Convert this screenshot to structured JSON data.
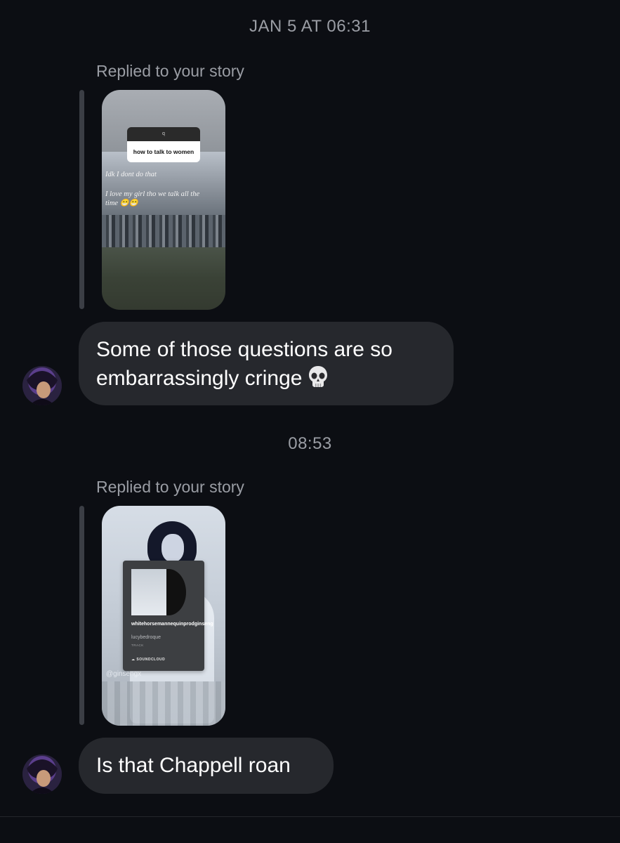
{
  "conversation": {
    "timestamp_1": "JAN 5 AT 06:31",
    "timestamp_2": "08:53",
    "messages": [
      {
        "reply_label": "Replied to your story",
        "story": {
          "question_sticker_top": "q",
          "question_sticker_text": "how to talk to women",
          "caption_line_1": "Idk  I dont do that",
          "caption_line_2": "I love my girl tho we talk all the time",
          "caption_emoji": "😁😁"
        },
        "text": "Some of those questions are so embarrassingly cringe",
        "emoji": "skull"
      },
      {
        "reply_label": "Replied to your story",
        "story": {
          "music_title": "whitehorsemannequinprodginseng",
          "music_artist": "lucybedroque",
          "music_type": "TRACK",
          "music_source": "SOUNDCLOUD",
          "handle": "@ginsengx"
        },
        "text": "Is that Chappell roan"
      }
    ]
  },
  "colors": {
    "background": "#0c0e13",
    "bubble": "#26282d",
    "meta_text": "#9a9da4"
  }
}
